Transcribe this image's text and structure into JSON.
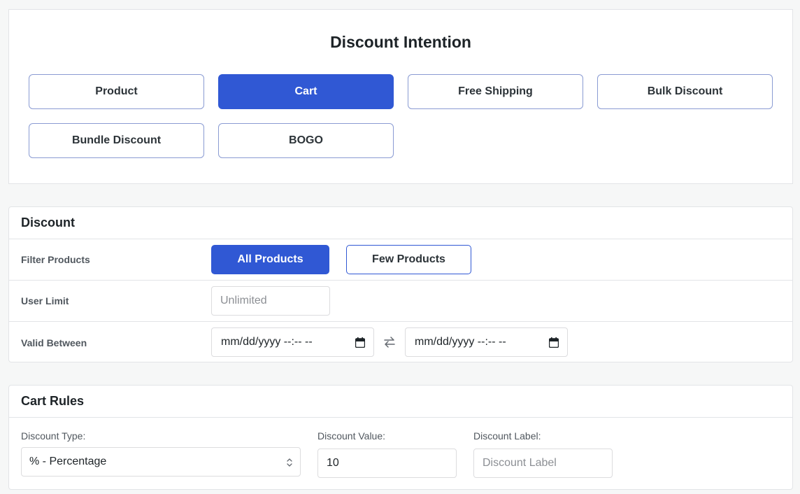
{
  "intention": {
    "title": "Discount Intention",
    "options": [
      "Product",
      "Cart",
      "Free Shipping",
      "Bulk Discount",
      "Bundle Discount",
      "BOGO"
    ],
    "selected": "Cart"
  },
  "discount": {
    "header": "Discount",
    "filter_products": {
      "label": "Filter Products",
      "options": [
        "All Products",
        "Few Products"
      ],
      "selected": "All Products"
    },
    "user_limit": {
      "label": "User Limit",
      "placeholder": "Unlimited",
      "value": ""
    },
    "valid_between": {
      "label": "Valid Between",
      "start_placeholder": "mm/dd/yyyy --:-- --",
      "end_placeholder": "mm/dd/yyyy --:-- --"
    }
  },
  "cart_rules": {
    "header": "Cart Rules",
    "discount_type": {
      "label": "Discount Type:",
      "value": "% - Percentage"
    },
    "discount_value": {
      "label": "Discount Value:",
      "value": "10"
    },
    "discount_label": {
      "label": "Discount Label:",
      "placeholder": "Discount Label",
      "value": ""
    }
  },
  "colors": {
    "accent": "#3058d4",
    "background": "#f6f7f7",
    "border": "#e2e4e7"
  },
  "icons": [
    "calendar-icon",
    "swap-arrows-icon",
    "select-updown-icon"
  ]
}
